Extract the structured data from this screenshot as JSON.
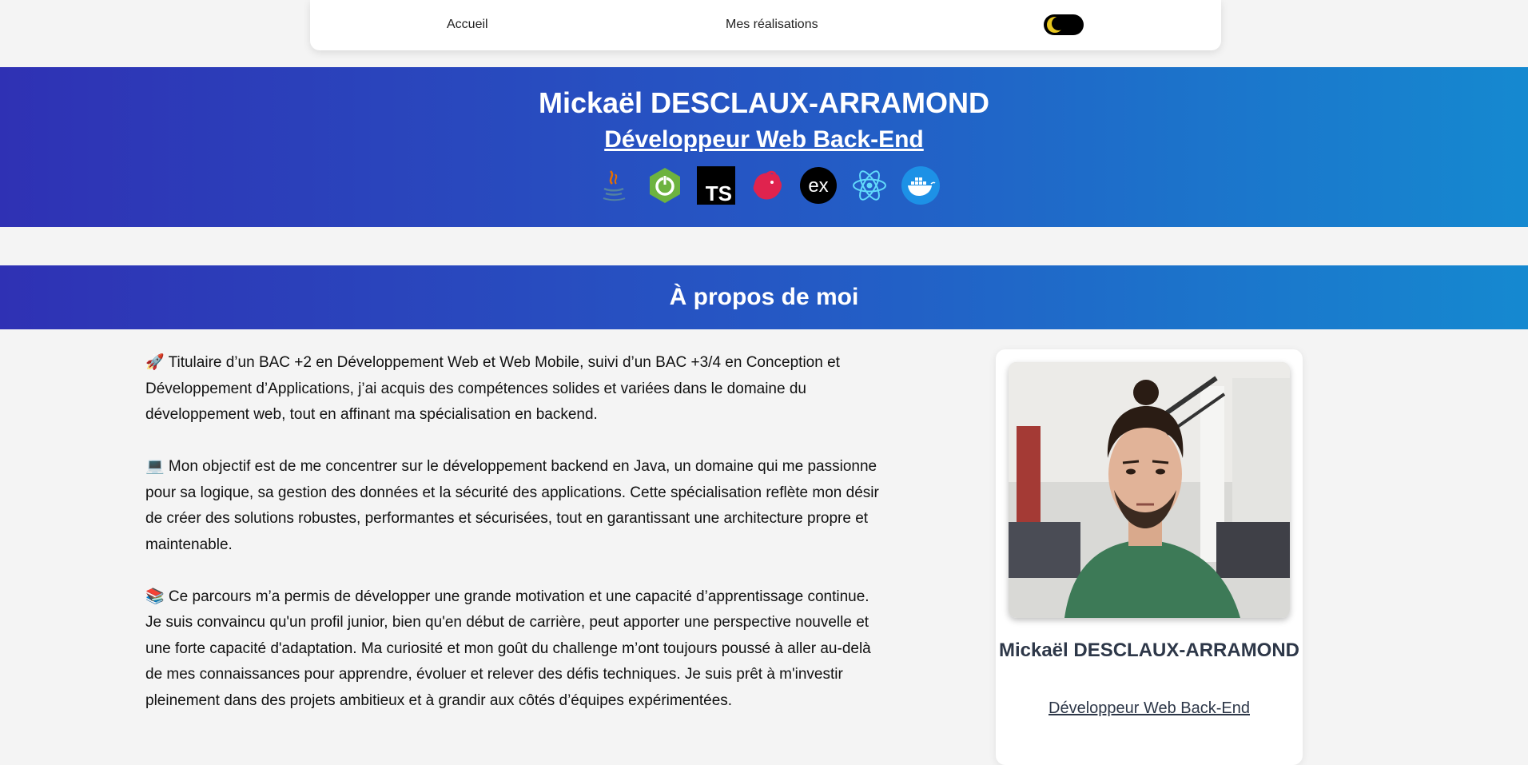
{
  "nav": {
    "home_label": "Accueil",
    "works_label": "Mes réalisations"
  },
  "hero": {
    "name": "Mickaël DESCLAUX-ARRAMOND",
    "role": "Développeur Web Back-End",
    "tech_icons": [
      "java-icon",
      "spring-boot-icon",
      "typescript-icon",
      "nestjs-icon",
      "express-icon",
      "react-icon",
      "docker-icon"
    ],
    "typescript_text": "TS",
    "express_text": "ex"
  },
  "about": {
    "title": "À propos de moi",
    "paragraphs": [
      "🚀 Titulaire d’un BAC +2 en Développement Web et Web Mobile, suivi d’un BAC +3/4 en Conception et Développement d’Applications, j’ai acquis des compétences solides et variées dans le domaine du développement web, tout en affinant ma spécialisation en backend.",
      "💻 Mon objectif est de me concentrer sur le développement backend en Java, un domaine qui me passionne pour sa logique, sa gestion des données et la sécurité des applications. Cette spécialisation reflète mon désir de créer des solutions robustes, performantes et sécurisées, tout en garantissant une architecture propre et maintenable.",
      "📚 Ce parcours m’a permis de développer une grande motivation et une capacité d’apprentissage continue. Je suis convaincu qu'un profil junior, bien qu'en début de carrière, peut apporter une perspective nouvelle et une forte capacité d'adaptation. Ma curiosité et mon goût du challenge m’ont toujours poussé à aller au-delà de mes connaissances pour apprendre, évoluer et relever des défis techniques. Je suis prêt à m'investir pleinement dans des projets ambitieux et à grandir aux côtés d’équipes expérimentées."
    ]
  },
  "card": {
    "name": "Mickaël DESCLAUX-ARRAMOND",
    "role": "Développeur Web Back-End"
  },
  "colors": {
    "gradient_start": "#2f31b4",
    "gradient_end": "#1589d0",
    "toggle_moon": "#e7c51e"
  }
}
